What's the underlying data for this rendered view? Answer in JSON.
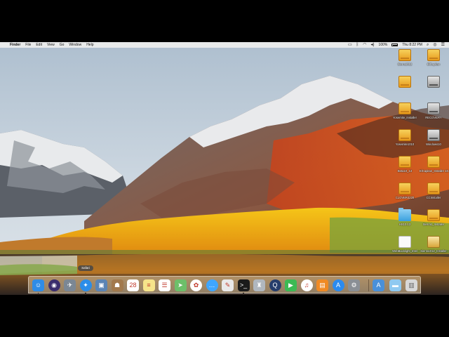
{
  "menubar": {
    "apple": "",
    "app_name": "Finder",
    "menus": [
      "File",
      "Edit",
      "View",
      "Go",
      "Window",
      "Help"
    ],
    "status": {
      "battery_percent": "100%",
      "clock": "Thu 8:22 PM"
    }
  },
  "desktop_icons": [
    {
      "label": "Sierra1012",
      "type": "hd-orange"
    },
    {
      "label": "ElCapitan",
      "type": "hd-orange"
    },
    {
      "label": "",
      "type": "hd-orange"
    },
    {
      "label": "",
      "type": "hd-gray"
    },
    {
      "label": "Yosemite_Installer",
      "type": "hd-orange"
    },
    {
      "label": "RECOVERY",
      "type": "hd-gray"
    },
    {
      "label": "Yosemite1010",
      "type": "hd-orange"
    },
    {
      "label": "Windows10",
      "type": "hd-gray"
    },
    {
      "label": "Beta10_13",
      "type": "hd-orange"
    },
    {
      "label": "ElCapitan_Installer 10.11",
      "type": "hd-orange"
    },
    {
      "label": "CLOVER4220",
      "type": "hd-orange"
    },
    {
      "label": "CCInstaller",
      "type": "hd-orange"
    },
    {
      "label": "HS10.13",
      "type": "folder"
    },
    {
      "label": "Sierra1_Installer",
      "type": "hd-orange"
    },
    {
      "label": "WebBacklight_Intel",
      "type": "shield"
    },
    {
      "label": "Sierra1012_Installer",
      "type": "pkg"
    }
  ],
  "dock": {
    "tooltip": "Safari",
    "apps": [
      {
        "name": "finder-icon",
        "glyph": "☺",
        "bg": "#2f8ce6"
      },
      {
        "name": "siri-icon",
        "glyph": "◉",
        "bg": "#3a2d6e"
      },
      {
        "name": "launchpad-icon",
        "glyph": "✈",
        "bg": "#7b8794"
      },
      {
        "name": "safari-icon",
        "glyph": "✦",
        "bg": "#2c8de8"
      },
      {
        "name": "photo-browser-icon",
        "glyph": "▣",
        "bg": "#5b84b4"
      },
      {
        "name": "contacts-icon",
        "glyph": "☗",
        "bg": "#a2794c"
      },
      {
        "name": "calendar-icon",
        "glyph": "28",
        "bg": "#ffffff"
      },
      {
        "name": "notes-icon",
        "glyph": "≡",
        "bg": "#f6e48a"
      },
      {
        "name": "reminders-icon",
        "glyph": "☰",
        "bg": "#ffffff"
      },
      {
        "name": "maps-icon",
        "glyph": "➤",
        "bg": "#6dbf6a"
      },
      {
        "name": "photos-icon",
        "glyph": "✿",
        "bg": "#ffffff"
      },
      {
        "name": "messages-icon",
        "glyph": "…",
        "bg": "#3ea6ff"
      },
      {
        "name": "textedit-icon",
        "glyph": "✎",
        "bg": "#e9e9e9"
      },
      {
        "name": "terminal-icon",
        "glyph": ">_",
        "bg": "#1b1b1b"
      },
      {
        "name": "preview-icon",
        "glyph": "♜",
        "bg": "#b0b7bf"
      },
      {
        "name": "quicktime-icon",
        "glyph": "Q",
        "bg": "#263d6b"
      },
      {
        "name": "facetime-icon",
        "glyph": "▶",
        "bg": "#3cba54"
      },
      {
        "name": "itunes-icon",
        "glyph": "♫",
        "bg": "#ffffff"
      },
      {
        "name": "ibooks-icon",
        "glyph": "▤",
        "bg": "#f08a24"
      },
      {
        "name": "app-store-icon",
        "glyph": "A",
        "bg": "#2b8bf0"
      },
      {
        "name": "system-preferences-icon",
        "glyph": "⚙",
        "bg": "#8a8f95"
      }
    ],
    "right": [
      {
        "name": "applications-folder-icon",
        "glyph": "A",
        "bg": "#4a90d9"
      },
      {
        "name": "downloads-folder-icon",
        "glyph": "▬",
        "bg": "#8fc9f0"
      },
      {
        "name": "trash-icon",
        "glyph": "▥",
        "bg": "#d8d8d8"
      }
    ]
  }
}
